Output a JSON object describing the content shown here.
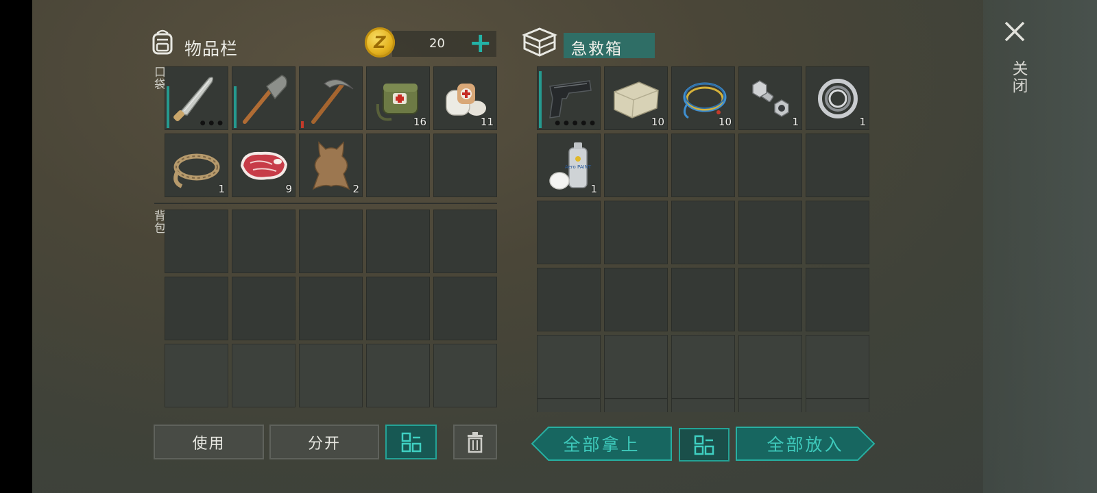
{
  "inventory": {
    "title": "物品栏",
    "coins": "20",
    "coin_symbol": "Z",
    "pocket_label": "口袋",
    "backpack_label": "背包",
    "pocket_slots": [
      {
        "icon": "machete-icon",
        "qty": "",
        "durability": 0.7,
        "dur_color": "#259a8f",
        "dots": "● ● ●"
      },
      {
        "icon": "shovel-icon",
        "qty": "",
        "durability": 0.7,
        "dur_color": "#259a8f"
      },
      {
        "icon": "pickaxe-icon",
        "qty": "",
        "durability": 0.12,
        "dur_color": "#c33a2a"
      },
      {
        "icon": "medkit-bag-icon",
        "qty": "16"
      },
      {
        "icon": "bandage-icon",
        "qty": "11"
      },
      {
        "icon": "rope-icon",
        "qty": "1"
      },
      {
        "icon": "raw-meat-icon",
        "qty": "9"
      },
      {
        "icon": "leather-hide-icon",
        "qty": "2"
      },
      {
        "icon": "",
        "qty": ""
      },
      {
        "icon": "",
        "qty": ""
      }
    ]
  },
  "container": {
    "title": "急救箱",
    "slots": [
      {
        "icon": "pistol-icon",
        "qty": "",
        "durability": 0.95,
        "dur_color": "#259a8f",
        "dots": "● ● ● ● ●"
      },
      {
        "icon": "stone-block-icon",
        "qty": "10"
      },
      {
        "icon": "wire-coil-icon",
        "qty": "10"
      },
      {
        "icon": "bolt-nut-icon",
        "qty": "1"
      },
      {
        "icon": "bearing-icon",
        "qty": "1"
      },
      {
        "icon": "spray-paint-icon",
        "qty": "1",
        "label": "Aero PAINT"
      }
    ]
  },
  "buttons": {
    "use": "使用",
    "split": "分开",
    "take_all": "全部拿上",
    "put_all": "全部放入"
  },
  "close_label": "关闭",
  "colors": {
    "accent": "#23b3a7",
    "slot": "#353935",
    "durability_ok": "#259a8f",
    "durability_low": "#c33a2a"
  }
}
